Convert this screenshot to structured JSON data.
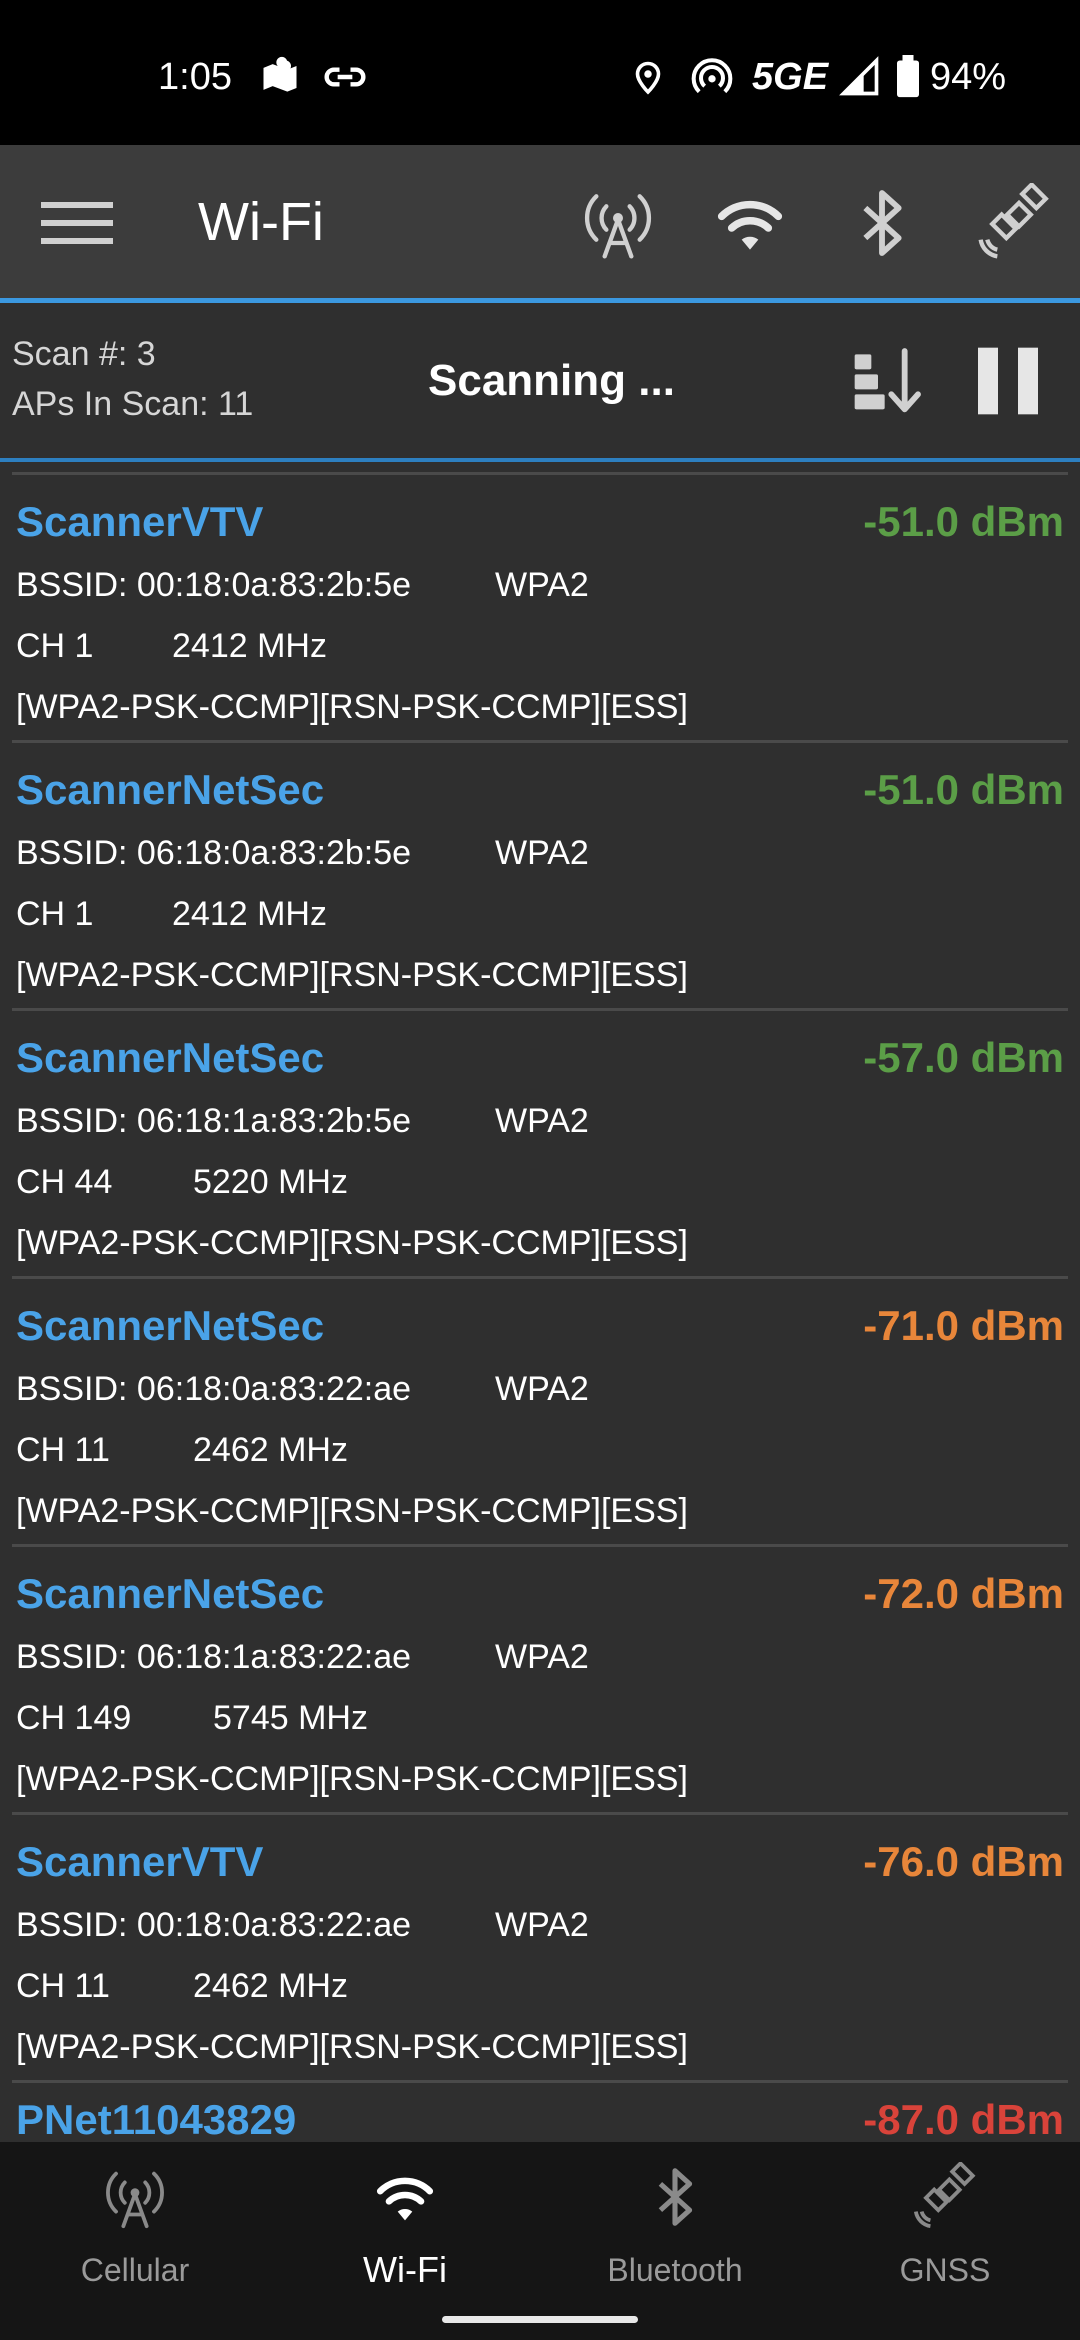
{
  "status_bar": {
    "time": "1:05",
    "network": "5GE",
    "battery": "94%",
    "icons": [
      "map-icon",
      "link-icon",
      "location-icon",
      "hotspot-icon",
      "signal-icon",
      "battery-icon"
    ]
  },
  "toolbar": {
    "title": "Wi-Fi",
    "icons": [
      "menu-icon",
      "cell-tower-icon",
      "wifi-icon",
      "bluetooth-icon",
      "satellite-icon"
    ]
  },
  "scan": {
    "scan_number": "Scan #: 3",
    "aps_in_scan": "APs In Scan: 11",
    "status": "Scanning ..."
  },
  "access_points": [
    {
      "ssid": "ScannerVTV",
      "signal": "-51.0 dBm",
      "bssid": "BSSID: 00:18:0a:83:2b:5e",
      "security": "WPA2",
      "channel": "CH 1",
      "frequency": "2412 MHz",
      "capabilities": "[WPA2-PSK-CCMP][RSN-PSK-CCMP][ESS]"
    },
    {
      "ssid": "ScannerNetSec",
      "signal": "-51.0 dBm",
      "bssid": "BSSID: 06:18:0a:83:2b:5e",
      "security": "WPA2",
      "channel": "CH 1",
      "frequency": "2412 MHz",
      "capabilities": "[WPA2-PSK-CCMP][RSN-PSK-CCMP][ESS]"
    },
    {
      "ssid": "ScannerNetSec",
      "signal": "-57.0 dBm",
      "bssid": "BSSID: 06:18:1a:83:2b:5e",
      "security": "WPA2",
      "channel": "CH 44",
      "frequency": "5220 MHz",
      "capabilities": "[WPA2-PSK-CCMP][RSN-PSK-CCMP][ESS]"
    },
    {
      "ssid": "ScannerNetSec",
      "signal": "-71.0 dBm",
      "bssid": "BSSID: 06:18:0a:83:22:ae",
      "security": "WPA2",
      "channel": "CH 11",
      "frequency": "2462 MHz",
      "capabilities": "[WPA2-PSK-CCMP][RSN-PSK-CCMP][ESS]"
    },
    {
      "ssid": "ScannerNetSec",
      "signal": "-72.0 dBm",
      "bssid": "BSSID: 06:18:1a:83:22:ae",
      "security": "WPA2",
      "channel": "CH 149",
      "frequency": "5745 MHz",
      "capabilities": "[WPA2-PSK-CCMP][RSN-PSK-CCMP][ESS]"
    },
    {
      "ssid": "ScannerVTV",
      "signal": "-76.0 dBm",
      "bssid": "BSSID: 00:18:0a:83:22:ae",
      "security": "WPA2",
      "channel": "CH 11",
      "frequency": "2462 MHz",
      "capabilities": "[WPA2-PSK-CCMP][RSN-PSK-CCMP][ESS]"
    },
    {
      "ssid": "PNet11043829",
      "signal": "-87.0 dBm",
      "bssid": "",
      "security": "",
      "channel": "",
      "frequency": "",
      "capabilities": ""
    }
  ],
  "signal_colors": {
    "good": "#5b9e47",
    "fair": "#e8863a",
    "poor": "#d9433a"
  },
  "bottom_nav": {
    "tabs": [
      {
        "label": "Cellular",
        "icon": "cell-tower-icon"
      },
      {
        "label": "Wi-Fi",
        "icon": "wifi-icon"
      },
      {
        "label": "Bluetooth",
        "icon": "bluetooth-icon"
      },
      {
        "label": "GNSS",
        "icon": "satellite-icon"
      }
    ],
    "active": "Wi-Fi"
  },
  "colors": {
    "accent": "#3b98e0",
    "ssid": "#4aa3e8",
    "background": "#2f2f2f",
    "toolbar": "#3c3c3c"
  }
}
